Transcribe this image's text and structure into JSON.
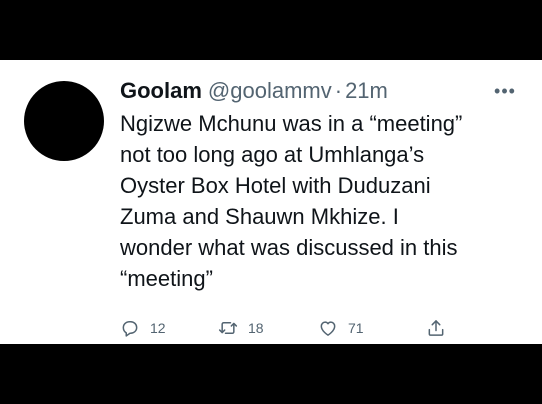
{
  "tweet": {
    "display_name": "Goolam",
    "handle": "@goolammv",
    "separator": "·",
    "time": "21m",
    "more_icon": "more-icon",
    "text_lines": [
      "Ngizwe Mchunu was in a “meeting”",
      "not too long ago at Umhlanga’s",
      "Oyster Box Hotel with Duduzani",
      "Zuma and Shauwn Mkhize. I",
      "wonder what was discussed in this",
      "“meeting”"
    ],
    "actions": {
      "reply": {
        "icon": "reply-icon",
        "count": "12"
      },
      "retweet": {
        "icon": "retweet-icon",
        "count": "18"
      },
      "like": {
        "icon": "heart-icon",
        "count": "71"
      },
      "share": {
        "icon": "share-icon"
      }
    }
  },
  "colors": {
    "background": "#000000",
    "card": "#ffffff",
    "text": "#0f1419",
    "secondary_text": "#536471",
    "avatar": "#000000"
  }
}
